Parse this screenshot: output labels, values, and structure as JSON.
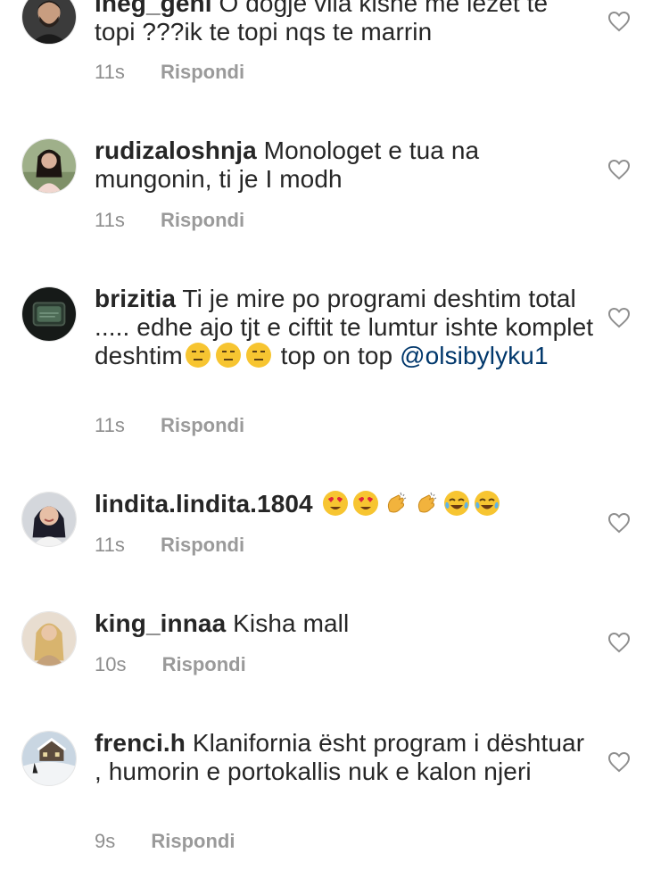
{
  "comments": [
    {
      "username": "ineg_geni",
      "text": "O dogje vila kishe me lezet te topi ???ik te topi nqs te marrin",
      "time": "11s",
      "reply_label": "Rispondi",
      "avatar": "avatar-man-beard"
    },
    {
      "username": "rudizaloshnja",
      "text": "Monologet e tua na mungonin, ti je I modh",
      "time": "11s",
      "reply_label": "Rispondi",
      "avatar": "avatar-woman-dark-hair"
    },
    {
      "username": "brizitia",
      "text_part1": "Ti je mire po programi deshtim total ..... edhe ajo tjt e ciftit te lumtur ishte komplet deshtim",
      "text_part2": " top on top ",
      "mention": "@olsibylyku1",
      "emojis": [
        "expressionless-face",
        "expressionless-face",
        "expressionless-face"
      ],
      "time": "11s",
      "reply_label": "Rispondi",
      "avatar": "avatar-old-tv"
    },
    {
      "username": "lindita.lindita.1804",
      "text": "",
      "emojis": [
        "heart-eyes-face",
        "heart-eyes-face",
        "clapping-hands",
        "clapping-hands",
        "tears-of-joy-face",
        "tears-of-joy-face"
      ],
      "time": "11s",
      "reply_label": "Rispondi",
      "avatar": "avatar-woman-smiling"
    },
    {
      "username": "king_innaa",
      "text": "Kisha mall",
      "time": "10s",
      "reply_label": "Rispondi",
      "avatar": "avatar-blonde-woman"
    },
    {
      "username": "frenci.h",
      "text": "Klanifornia ësht program i dështuar , humorin e portokallis nuk e kalon njeri",
      "time": "9s",
      "reply_label": "Rispondi",
      "avatar": "avatar-snow-house"
    }
  ],
  "colors": {
    "text": "#262626",
    "meta": "#8e8e8e",
    "mention": "#00376b",
    "heart_outline": "#8e8e8e"
  },
  "icons": {
    "like": "heart-outline-icon"
  }
}
